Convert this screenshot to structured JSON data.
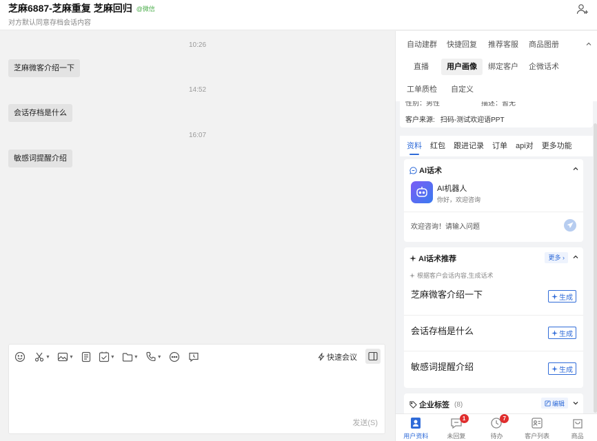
{
  "header": {
    "title": "芝麻6887-芝麻重复 芝麻回归",
    "tag": "@微信",
    "subtitle": "对方默认同意存档会话内容"
  },
  "chat": {
    "messages": [
      {
        "time": "10:26",
        "text": "芝麻微客介绍一下"
      },
      {
        "time": "14:52",
        "text": "会话存档是什么"
      },
      {
        "time": "16:07",
        "text": "敏感词提醒介绍"
      }
    ]
  },
  "composer": {
    "quick_meeting": "快速会议",
    "send": "发送(S)"
  },
  "right_panel": {
    "top_menu": {
      "row1": [
        "自动建群",
        "快捷回复",
        "推荐客服",
        "商品图册"
      ],
      "row2": [
        "直播",
        "用户画像",
        "绑定客户",
        "企微话术"
      ],
      "row3": [
        "工单质检",
        "自定义"
      ],
      "active": "用户画像"
    },
    "customer": {
      "cut_row": [
        "性别：",
        "男性",
        "描述：",
        "暂无"
      ],
      "source_label": "客户来源:",
      "source_value": "扫码-测试欢迎语PPT"
    },
    "tabs": [
      "资料",
      "红包",
      "跟进记录",
      "订单",
      "api对",
      "更多功能"
    ],
    "active_tab": "资料",
    "ai_card": {
      "title": "AI话术",
      "bot_name": "AI机器人",
      "greeting": "你好，欢迎咨询",
      "input_placeholder": "欢迎咨询！请输入问题"
    },
    "rec_card": {
      "title": "AI话术推荐",
      "more": "更多",
      "hint": "根据客户会话内容,生成话术",
      "generate": "生成",
      "items": [
        "芝麻微客介绍一下",
        "会话存档是什么",
        "敏感词提醒介绍"
      ]
    },
    "tag_card": {
      "title": "企业标签",
      "count": "(8)",
      "edit": "编辑"
    },
    "bottom_nav": [
      {
        "label": "用户资料",
        "badge": ""
      },
      {
        "label": "未回复",
        "badge": "1"
      },
      {
        "label": "待办",
        "badge": "7"
      },
      {
        "label": "客户列表",
        "badge": ""
      },
      {
        "label": "商品",
        "badge": ""
      }
    ],
    "accent_color": "#2f6bd8"
  }
}
